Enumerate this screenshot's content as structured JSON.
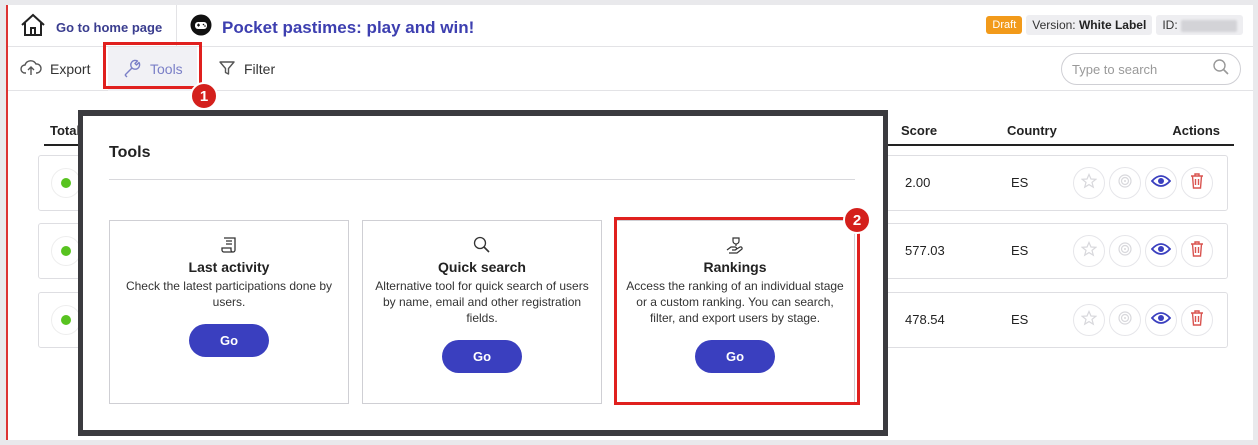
{
  "header": {
    "home_label": "Go to home page",
    "game_title": "Pocket pastimes: play and win!",
    "draft_badge": "Draft",
    "version_label": "Version:",
    "version_value": "White Label",
    "id_label": "ID:"
  },
  "toolbar": {
    "export_label": "Export",
    "tools_label": "Tools",
    "filter_label": "Filter",
    "search_placeholder": "Type to search"
  },
  "steps": {
    "step1": "1",
    "step2": "2"
  },
  "table": {
    "columns": {
      "total": "Total",
      "score": "Score",
      "country": "Country",
      "actions": "Actions"
    },
    "rows": [
      {
        "score": "2.00",
        "country": "ES",
        "status": "active"
      },
      {
        "score": "577.03",
        "country": "ES",
        "status": "active"
      },
      {
        "score": "478.54",
        "country": "ES",
        "status": "active"
      }
    ]
  },
  "modal": {
    "title": "Tools",
    "cards": [
      {
        "icon": "scroll-icon",
        "title": "Last activity",
        "description": "Check the latest participations done by users.",
        "button": "Go"
      },
      {
        "icon": "magnifier-icon",
        "title": "Quick search",
        "description": "Alternative tool for quick search of users by name, email and other registration fields.",
        "button": "Go"
      },
      {
        "icon": "trophy-hand-icon",
        "title": "Rankings",
        "description": "Access the ranking of an individual stage or a custom ranking. You can search, filter, and export users by stage.",
        "button": "Go"
      }
    ]
  },
  "colors": {
    "accent": "#3a3fbf",
    "title": "#3d3fb0",
    "draft": "#f29a1a",
    "highlight": "#e0201e",
    "active_dot": "#58c320",
    "delete": "#d9534f"
  }
}
